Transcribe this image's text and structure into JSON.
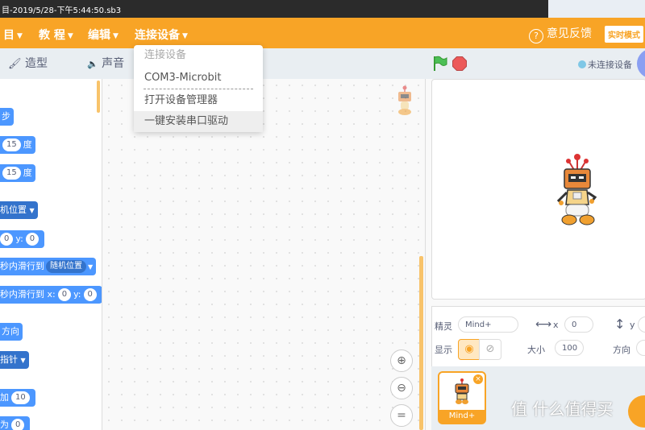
{
  "titlebar": {
    "text": "目-2019/5/28-下午5:44:50.sb3"
  },
  "menu": {
    "items": [
      {
        "label": "目"
      },
      {
        "label": "教 程"
      },
      {
        "label": "编辑"
      },
      {
        "label": "连接设备"
      }
    ],
    "feedback": "意见反馈",
    "realtime": "实时模式"
  },
  "tabs": {
    "costumes": "造型",
    "sounds": "声音"
  },
  "dropdown": {
    "title": "连接设备",
    "items": [
      "COM3-Microbit",
      "打开设备管理器",
      "一键安装串口驱动"
    ]
  },
  "palette": {
    "steps": "步",
    "turn1": {
      "value": "15",
      "unit": "度"
    },
    "turn2": {
      "value": "15",
      "unit": "度"
    },
    "goto": "机位置",
    "goxy": {
      "y_label": "y:",
      "y": "0"
    },
    "glide1": {
      "text": "秒内滑行到",
      "option": "随机位置"
    },
    "glide2": {
      "text": "秒内滑行到 x:",
      "x": "0",
      "y_label": "y:",
      "y": "0"
    },
    "direction": "方向",
    "rotate": "指针",
    "changex": {
      "text": "加",
      "value": "10"
    },
    "setx": {
      "text": "为",
      "value": "0"
    }
  },
  "stage": {
    "status": "未连接设备"
  },
  "sprite_info": {
    "sprite_label": "精灵",
    "sprite_name": "Mind+",
    "x_label": "x",
    "x": "0",
    "y_label": "y",
    "show_label": "显示",
    "size_label": "大小",
    "size": "100",
    "direction_label": "方向"
  },
  "sprite_list": {
    "name": "Mind+"
  },
  "watermark": "值 什么值得买"
}
